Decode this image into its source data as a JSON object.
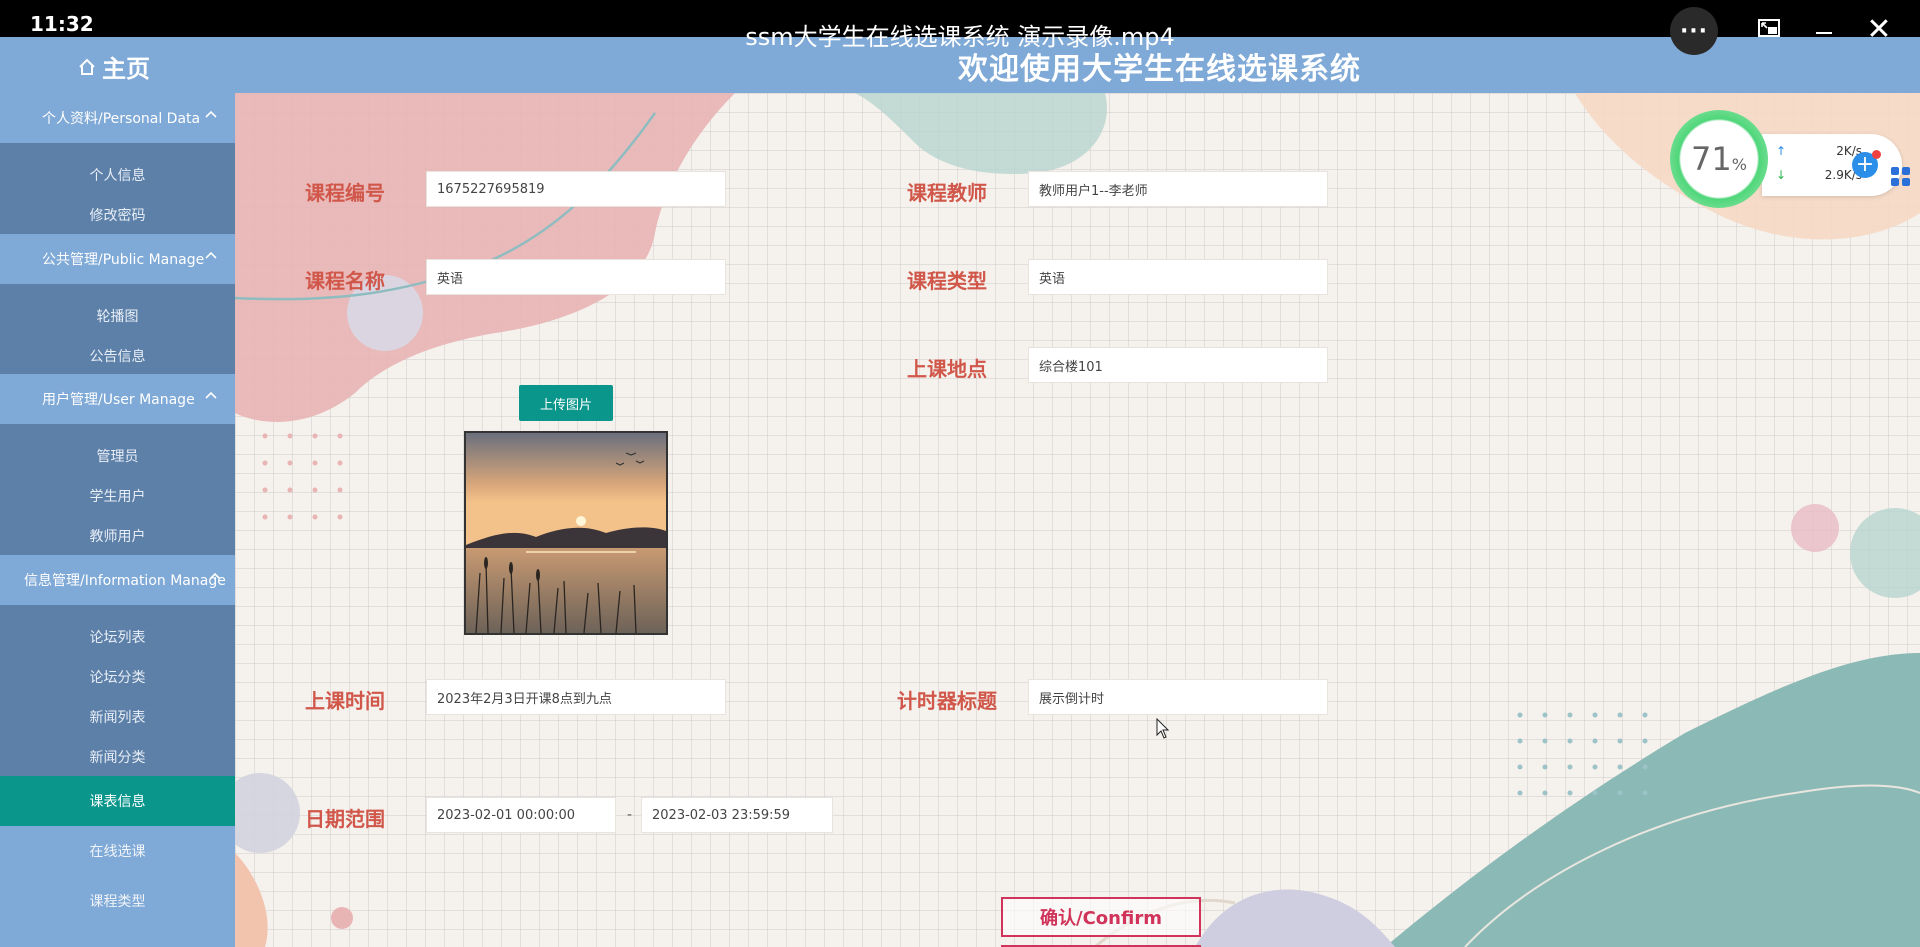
{
  "player": {
    "clock": "11:32",
    "video_title": "ssm大学生在线选课系统 演示录像.mp4",
    "more_label": "···",
    "close_label": "✕"
  },
  "topbar": {
    "home_label": "主页",
    "app_title": "欢迎使用大学生在线选课系统"
  },
  "sidebar": {
    "groups": [
      {
        "label": "个人资料/Personal Data",
        "items": [
          "个人信息",
          "修改密码"
        ]
      },
      {
        "label": "公共管理/Public Manage",
        "items": [
          "轮播图",
          "公告信息"
        ]
      },
      {
        "label": "用户管理/User Manage",
        "items": [
          "管理员",
          "学生用户",
          "教师用户"
        ]
      },
      {
        "label": "信息管理/Information Manage",
        "items": [
          "论坛列表",
          "论坛分类",
          "新闻列表",
          "新闻分类"
        ]
      }
    ],
    "active_item": "课表信息",
    "extra_items": [
      "在线选课",
      "课程类型"
    ]
  },
  "form": {
    "course_no_label": "课程编号",
    "course_no_value": "1675227695819",
    "teacher_label": "课程教师",
    "teacher_value": "教师用户1--李老师",
    "course_name_label": "课程名称",
    "course_name_value": "英语",
    "course_type_label": "课程类型",
    "course_type_value": "英语",
    "upload_label": "上传图片",
    "location_label": "上课地点",
    "location_value": "综合楼101",
    "time_label": "上课时间",
    "time_value": "2023年2月3日开课8点到九点",
    "timer_title_label": "计时器标题",
    "timer_title_value": "展示倒计时",
    "date_range_label": "日期范围",
    "date_start": "2023-02-01 00:00:00",
    "date_separator": "-",
    "date_end": "2023-02-03 23:59:59",
    "confirm_label": "确认/Confirm"
  },
  "widget": {
    "percent": "71",
    "percent_sign": "%",
    "upload_speed": "2K/s",
    "download_speed": "2.9K/s",
    "up_arrow": "↑",
    "down_arrow": "↓",
    "plus": "+"
  },
  "colors": {
    "accent_teal": "#0b968c",
    "nav_blue": "#7fa9d6",
    "sidebar_dark": "#5d80a8",
    "label_red": "#d0574a",
    "confirm_pink": "#d0345a"
  }
}
